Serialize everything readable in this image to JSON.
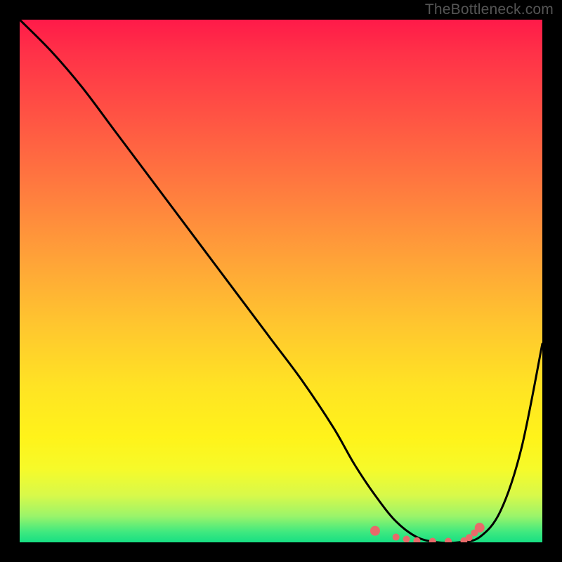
{
  "watermark": "TheBottleneck.com",
  "chart_data": {
    "type": "line",
    "title": "",
    "xlabel": "",
    "ylabel": "",
    "xlim": [
      0,
      100
    ],
    "ylim": [
      0,
      100
    ],
    "x": [
      0,
      6,
      12,
      18,
      24,
      30,
      36,
      42,
      48,
      54,
      60,
      64,
      68,
      72,
      76,
      80,
      84,
      88,
      92,
      96,
      100
    ],
    "values": [
      100,
      94,
      87,
      79,
      71,
      63,
      55,
      47,
      39,
      31,
      22,
      15,
      9,
      4,
      1,
      0,
      0,
      1,
      6,
      18,
      38
    ],
    "marker_points": {
      "x": [
        68,
        72,
        74,
        76,
        79,
        82,
        85,
        86,
        87,
        88
      ],
      "y": [
        2.2,
        1.0,
        0.6,
        0.3,
        0.2,
        0.2,
        0.3,
        0.9,
        1.8,
        2.8
      ]
    },
    "gradient_stops": [
      {
        "pos": 0.0,
        "color": "#ff1a49"
      },
      {
        "pos": 0.06,
        "color": "#ff3048"
      },
      {
        "pos": 0.18,
        "color": "#ff5244"
      },
      {
        "pos": 0.32,
        "color": "#ff7a3f"
      },
      {
        "pos": 0.46,
        "color": "#ffa338"
      },
      {
        "pos": 0.58,
        "color": "#ffc52f"
      },
      {
        "pos": 0.7,
        "color": "#ffe324"
      },
      {
        "pos": 0.8,
        "color": "#fff31a"
      },
      {
        "pos": 0.86,
        "color": "#f6fa2a"
      },
      {
        "pos": 0.91,
        "color": "#d8f94a"
      },
      {
        "pos": 0.95,
        "color": "#9af46a"
      },
      {
        "pos": 0.98,
        "color": "#3fe97f"
      },
      {
        "pos": 1.0,
        "color": "#17df83"
      }
    ],
    "marker_color": "#e86a6a",
    "line_color": "#000000"
  }
}
